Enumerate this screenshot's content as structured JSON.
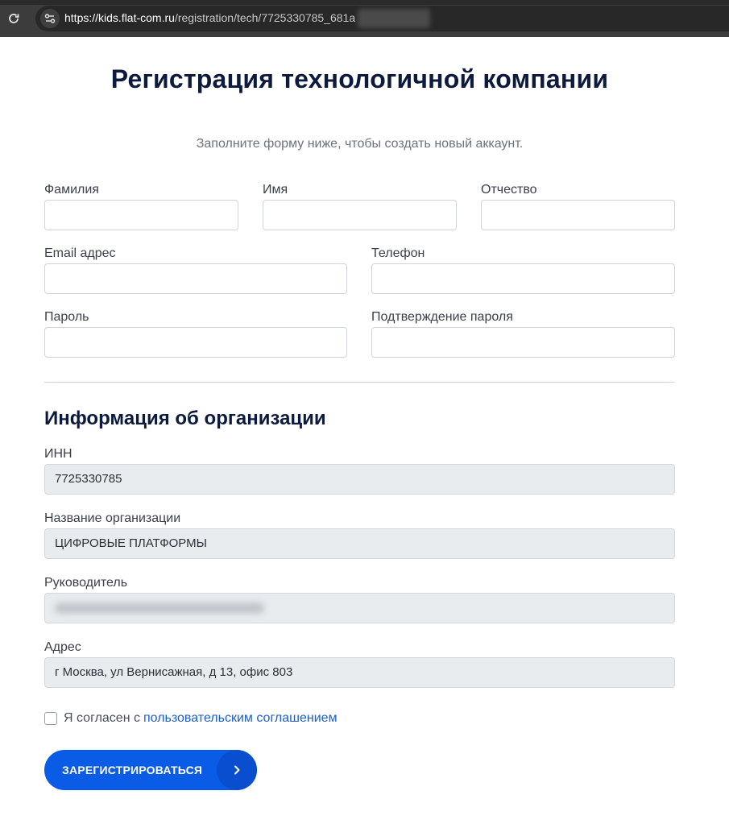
{
  "browser": {
    "url_host": "https://kids.flat-com.ru",
    "url_path": "/registration/tech/7725330785_681a"
  },
  "header": {
    "title": "Регистрация технологичной компании",
    "subtitle": "Заполните форму ниже, чтобы создать новый аккаунт."
  },
  "personal": {
    "last_name_label": "Фамилия",
    "first_name_label": "Имя",
    "middle_name_label": "Отчество",
    "email_label": "Email адрес",
    "phone_label": "Телефон",
    "password_label": "Пароль",
    "password_confirm_label": "Подтверждение пароля"
  },
  "organization": {
    "section_title": "Информация об организации",
    "inn_label": "ИНН",
    "inn_value": "7725330785",
    "name_label": "Название организации",
    "name_value": "ЦИФРОВЫЕ ПЛАТФОРМЫ",
    "director_label": "Руководитель",
    "address_label": "Адрес",
    "address_value": "г Москва, ул Вернисажная, д 13, офис 803"
  },
  "agreement": {
    "text": "Я согласен с",
    "link": "пользовательским соглашением"
  },
  "submit": {
    "label": "ЗАРЕГИСТРИРОВАТЬСЯ"
  }
}
